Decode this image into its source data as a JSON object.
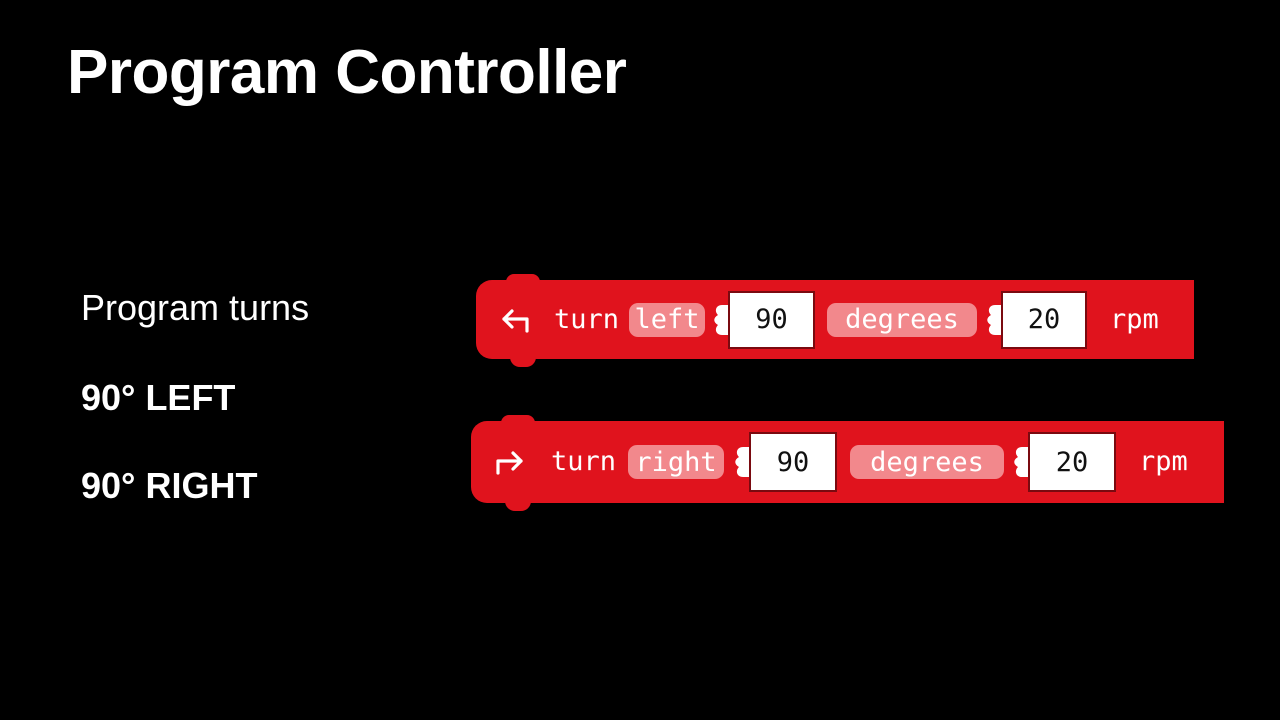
{
  "slide": {
    "title": "Program Controller",
    "intro": "Program turns",
    "left_label": "90° LEFT",
    "right_label": "90° RIGHT"
  },
  "blocks": [
    {
      "icon": "turn-left-arrow-icon",
      "verb": "turn",
      "direction": "left",
      "angle": "90",
      "angle_unit": "degrees",
      "speed": "20",
      "speed_unit": "rpm"
    },
    {
      "icon": "turn-right-arrow-icon",
      "verb": "turn",
      "direction": "right",
      "angle": "90",
      "angle_unit": "degrees",
      "speed": "20",
      "speed_unit": "rpm"
    }
  ],
  "colors": {
    "background": "#000000",
    "block_fill": "#e0131d",
    "pill_fill": "#f2888c",
    "text": "#ffffff"
  }
}
